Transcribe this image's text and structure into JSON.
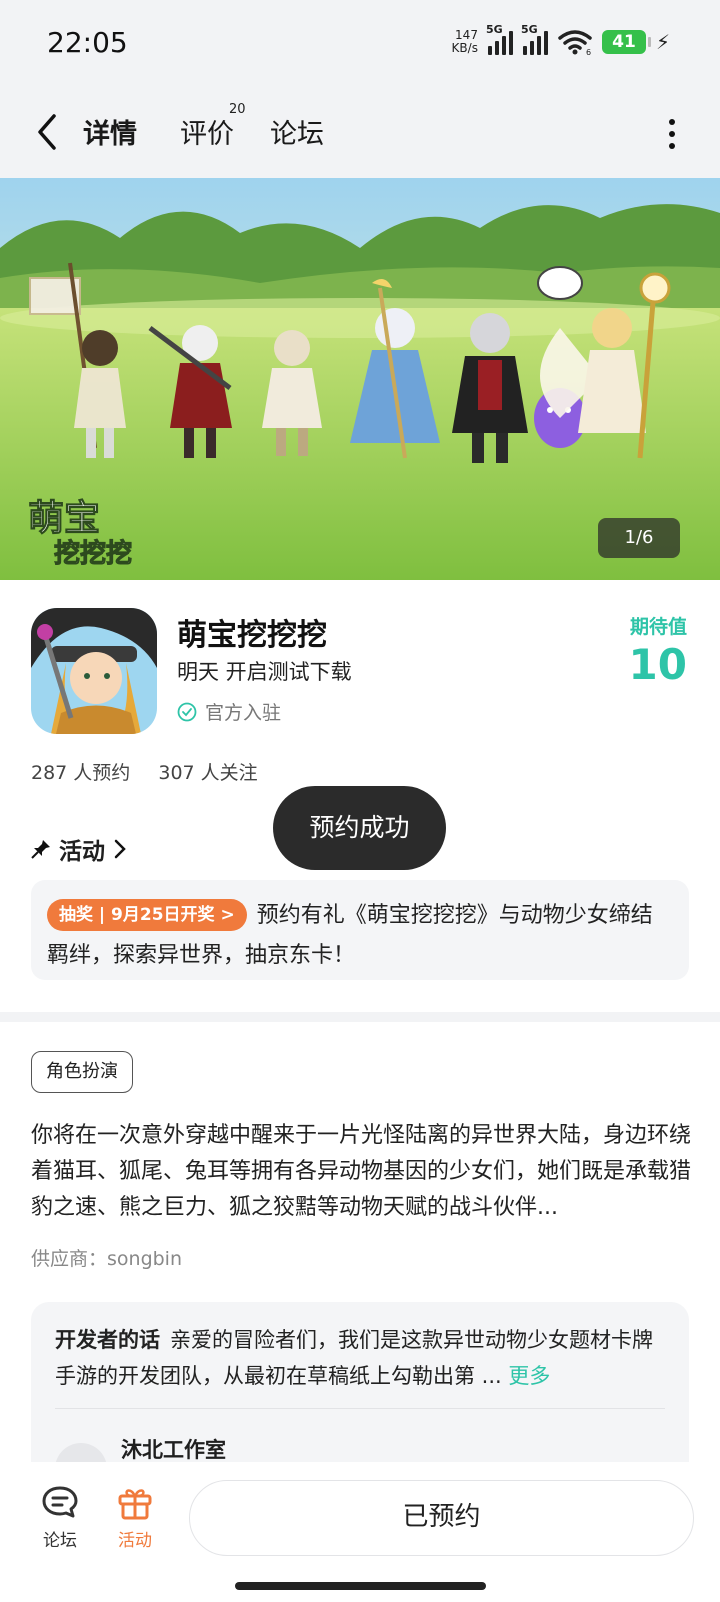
{
  "status_bar": {
    "time": "22:05",
    "net_speed_value": "147",
    "net_speed_unit": "KB/s",
    "sim1_label": "5G",
    "sim2_label": "5G",
    "wifi_label": "6",
    "battery": "41"
  },
  "nav": {
    "tabs": [
      {
        "label": "详情",
        "active": true
      },
      {
        "label": "评价",
        "badge": "20"
      },
      {
        "label": "论坛"
      }
    ]
  },
  "banner": {
    "logo_text_line1": "萌宝",
    "logo_text_line2": "挖挖挖",
    "page_indicator": "1/6"
  },
  "app": {
    "name": "萌宝挖挖挖",
    "subtitle": "明天 开启测试下载",
    "verified": "官方入驻",
    "expect_label": "期待值",
    "expect_value": "10",
    "reservations": "287 人预约",
    "followers": "307 人关注"
  },
  "toast": "预约成功",
  "activity": {
    "heading": "活动",
    "tag": "抽奖 | 9月25日开奖 >",
    "text": "预约有礼《萌宝挖挖挖》与动物少女缔结羁绊，探索异世界，抽京东卡！"
  },
  "details": {
    "genre_tag": "角色扮演",
    "description": "你将在一次意外穿越中醒来于一片光怪陆离的异世界大陆，身边环绕着猫耳、狐尾、兔耳等拥有各异动物基因的少女们，她们既是承载猎豹之速、熊之巨力、狐之狡黠等动物天赋的战斗伙伴...",
    "supplier": "供应商：songbin"
  },
  "developer": {
    "title": "开发者的话",
    "text": "亲爱的冒险者们，我们是这款异世动物少女题材卡牌手游的开发团队，从最初在草稿纸上勾勒出第 ...",
    "more": "更多",
    "studio": "沐北工作室"
  },
  "bottom_bar": {
    "forum_label": "论坛",
    "activity_label": "活动",
    "reserved_button": "已预约"
  },
  "colors": {
    "accent": "#2ec4a8",
    "orange": "#f07a3c",
    "dark_toast": "#2b2b2b"
  }
}
